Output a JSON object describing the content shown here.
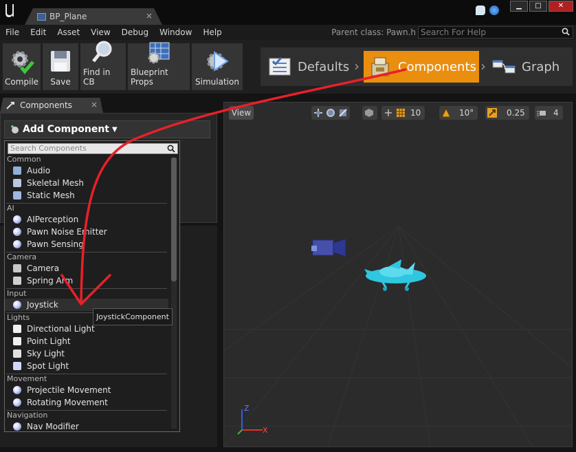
{
  "window": {
    "tab_title": "BP_Plane",
    "tab_close": "×"
  },
  "menu": {
    "items": [
      "File",
      "Edit",
      "Asset",
      "View",
      "Debug",
      "Window",
      "Help"
    ],
    "parent_class": "Parent class: Pawn.h",
    "search_placeholder": "Search For Help"
  },
  "toolbar": {
    "buttons": [
      {
        "label": "Compile",
        "icon": "compile-icon"
      },
      {
        "label": "Save",
        "icon": "save-icon"
      },
      {
        "label": "Find in CB",
        "icon": "find-icon"
      },
      {
        "label": "Blueprint Props",
        "icon": "blueprint-props-icon"
      },
      {
        "label": "Simulation",
        "icon": "simulation-icon"
      }
    ],
    "modes": [
      {
        "label": "Defaults",
        "icon": "defaults-icon"
      },
      {
        "label": "Components",
        "icon": "components-icon",
        "active": true
      },
      {
        "label": "Graph",
        "icon": "graph-icon"
      }
    ]
  },
  "components_panel": {
    "tab_label": "Components",
    "add_button": "Add Component",
    "search_placeholder": "Search Components"
  },
  "component_list": [
    {
      "category": "Common",
      "items": [
        {
          "label": "Audio",
          "icon": "audio-icon"
        },
        {
          "label": "Skeletal Mesh",
          "icon": "skeletal-mesh-icon"
        },
        {
          "label": "Static Mesh",
          "icon": "static-mesh-icon"
        }
      ]
    },
    {
      "category": "AI",
      "items": [
        {
          "label": "AIPerception",
          "icon": "sphere-icon"
        },
        {
          "label": "Pawn Noise Emitter",
          "icon": "sphere-icon"
        },
        {
          "label": "Pawn Sensing",
          "icon": "sphere-icon"
        }
      ]
    },
    {
      "category": "Camera",
      "items": [
        {
          "label": "Camera",
          "icon": "camera-icon"
        },
        {
          "label": "Spring Arm",
          "icon": "spring-arm-icon"
        }
      ]
    },
    {
      "category": "Input",
      "items": [
        {
          "label": "Joystick",
          "icon": "sphere-icon",
          "highlighted": true
        }
      ]
    },
    {
      "category": "Lights",
      "items": [
        {
          "label": "Directional Light",
          "icon": "directional-light-icon"
        },
        {
          "label": "Point Light",
          "icon": "point-light-icon"
        },
        {
          "label": "Sky Light",
          "icon": "sky-light-icon"
        },
        {
          "label": "Spot Light",
          "icon": "spot-light-icon"
        }
      ]
    },
    {
      "category": "Movement",
      "items": [
        {
          "label": "Projectile Movement",
          "icon": "sphere-icon"
        },
        {
          "label": "Rotating Movement",
          "icon": "sphere-icon"
        }
      ]
    },
    {
      "category": "Navigation",
      "items": [
        {
          "label": "Nav Modifier",
          "icon": "sphere-icon"
        }
      ]
    }
  ],
  "tooltip": "JoystickComponent",
  "viewport": {
    "view_button": "View",
    "grid_snap": "10",
    "rotation_snap": "10°",
    "scale_snap": "0.25",
    "camera_speed": "4",
    "axis_z": "Z",
    "axis_x": "X"
  },
  "colors": {
    "accent": "#ea8e10",
    "annotation_arrow": "#e8202a",
    "mesh": "#2fc6e0"
  }
}
